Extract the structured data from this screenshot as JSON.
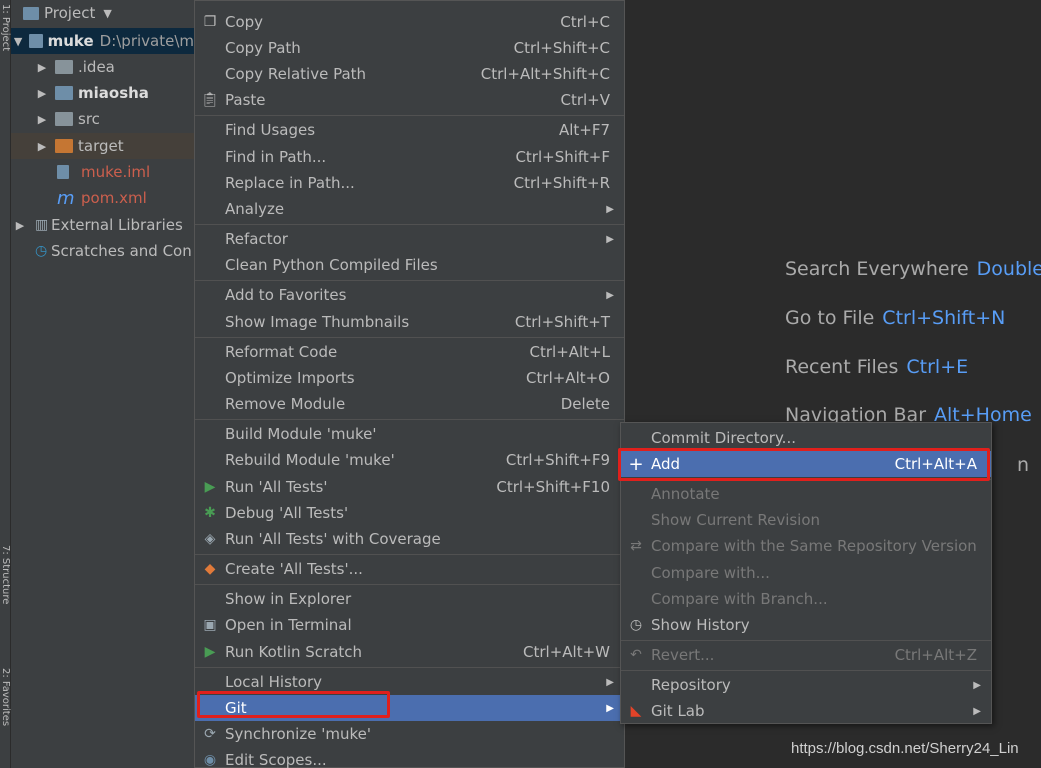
{
  "side_tabs": {
    "project": "1: Project",
    "structure": "7: Structure",
    "favorites": "2: Favorites"
  },
  "project_panel": {
    "title": "Project",
    "tree": [
      {
        "label": "muke",
        "path": "D:\\private\\m",
        "kind": "module"
      },
      {
        "label": ".idea",
        "kind": "folder"
      },
      {
        "label": "miaosha",
        "kind": "module"
      },
      {
        "label": "src",
        "kind": "folder"
      },
      {
        "label": "target",
        "kind": "folder-orange"
      },
      {
        "label": "muke.iml",
        "kind": "iml"
      },
      {
        "label": "pom.xml",
        "kind": "maven"
      },
      {
        "label": "External Libraries",
        "kind": "libs"
      },
      {
        "label": "Scratches and Con",
        "kind": "scratches"
      }
    ]
  },
  "context_menu": {
    "items": [
      {
        "label": "Copy",
        "shortcut": "Ctrl+C"
      },
      {
        "label": "Copy Path",
        "shortcut": "Ctrl+Shift+C"
      },
      {
        "label": "Copy Relative Path",
        "shortcut": "Ctrl+Alt+Shift+C"
      },
      {
        "label": "Paste",
        "shortcut": "Ctrl+V"
      },
      {
        "label": "Find Usages",
        "shortcut": "Alt+F7"
      },
      {
        "label": "Find in Path...",
        "shortcut": "Ctrl+Shift+F"
      },
      {
        "label": "Replace in Path...",
        "shortcut": "Ctrl+Shift+R"
      },
      {
        "label": "Analyze",
        "shortcut": ""
      },
      {
        "label": "Refactor",
        "shortcut": ""
      },
      {
        "label": "Clean Python Compiled Files",
        "shortcut": ""
      },
      {
        "label": "Add to Favorites",
        "shortcut": ""
      },
      {
        "label": "Show Image Thumbnails",
        "shortcut": "Ctrl+Shift+T"
      },
      {
        "label": "Reformat Code",
        "shortcut": "Ctrl+Alt+L"
      },
      {
        "label": "Optimize Imports",
        "shortcut": "Ctrl+Alt+O"
      },
      {
        "label": "Remove Module",
        "shortcut": "Delete"
      },
      {
        "label": "Build Module 'muke'",
        "shortcut": ""
      },
      {
        "label": "Rebuild Module 'muke'",
        "shortcut": "Ctrl+Shift+F9"
      },
      {
        "label": "Run 'All Tests'",
        "shortcut": "Ctrl+Shift+F10"
      },
      {
        "label": "Debug 'All Tests'",
        "shortcut": ""
      },
      {
        "label": "Run 'All Tests' with Coverage",
        "shortcut": ""
      },
      {
        "label": "Create 'All Tests'...",
        "shortcut": ""
      },
      {
        "label": "Show in Explorer",
        "shortcut": ""
      },
      {
        "label": "Open in Terminal",
        "shortcut": ""
      },
      {
        "label": "Run Kotlin Scratch",
        "shortcut": "Ctrl+Alt+W"
      },
      {
        "label": "Local History",
        "shortcut": ""
      },
      {
        "label": "Git",
        "shortcut": ""
      },
      {
        "label": "Synchronize 'muke'",
        "shortcut": ""
      },
      {
        "label": "Edit Scopes...",
        "shortcut": ""
      }
    ]
  },
  "git_submenu": {
    "items": [
      {
        "label": "Commit Directory...",
        "shortcut": ""
      },
      {
        "label": "Add",
        "shortcut": "Ctrl+Alt+A"
      },
      {
        "label": "Annotate",
        "shortcut": ""
      },
      {
        "label": "Show Current Revision",
        "shortcut": ""
      },
      {
        "label": "Compare with the Same Repository Version",
        "shortcut": ""
      },
      {
        "label": "Compare with...",
        "shortcut": ""
      },
      {
        "label": "Compare with Branch...",
        "shortcut": ""
      },
      {
        "label": "Show History",
        "shortcut": ""
      },
      {
        "label": "Revert...",
        "shortcut": "Ctrl+Alt+Z"
      },
      {
        "label": "Repository",
        "shortcut": ""
      },
      {
        "label": "Git Lab",
        "shortcut": ""
      }
    ]
  },
  "editor_hints": [
    {
      "label": "Search Everywhere",
      "shortcut": "Double"
    },
    {
      "label": "Go to File",
      "shortcut": "Ctrl+Shift+N"
    },
    {
      "label": "Recent Files",
      "shortcut": "Ctrl+E"
    },
    {
      "label": "Navigation Bar",
      "shortcut": "Alt+Home"
    },
    {
      "label": "",
      "shortcut": "n"
    }
  ],
  "watermark": "https://blog.csdn.net/Sherry24_Lin",
  "colors": {
    "highlight": "#4b6eaf",
    "annotation_box": "#e0201c",
    "shortcut_blue": "#589df6",
    "menu_bg": "#3c3f41"
  },
  "icons": {
    "submenu": "chevron-right-icon",
    "tree_expand": "triangle-right-icon"
  }
}
